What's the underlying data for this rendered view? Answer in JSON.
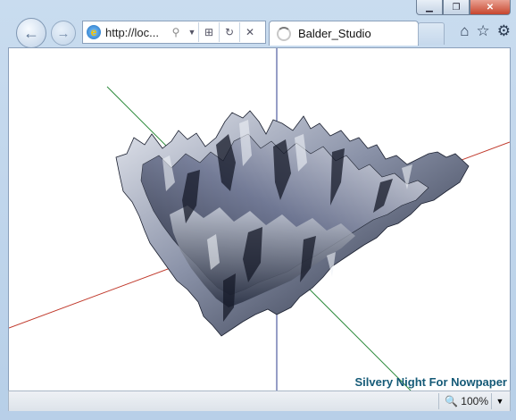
{
  "browser": {
    "address_url": "http://loc...",
    "tab_title": "Balder_Studio"
  },
  "icons": {
    "back": "back-arrow-icon",
    "forward": "forward-arrow-icon",
    "ie": "ie-logo-icon",
    "search": "search-icon",
    "dropdown": "chevron-down-icon",
    "compat": "compatibility-view-icon",
    "refresh": "refresh-icon",
    "stop": "stop-icon",
    "home": "home-icon",
    "favorites": "star-icon",
    "tools": "gear-icon"
  },
  "content": {
    "watermark": "Silvery Night For Nowpaper"
  },
  "statusbar": {
    "zoom": "100%"
  },
  "colors": {
    "axis_x": "#c0392b",
    "axis_y": "#2c3e8c",
    "axis_z": "#2e8b3d",
    "terrain_light": "#d9dde6",
    "terrain_dark": "#1c2233"
  }
}
